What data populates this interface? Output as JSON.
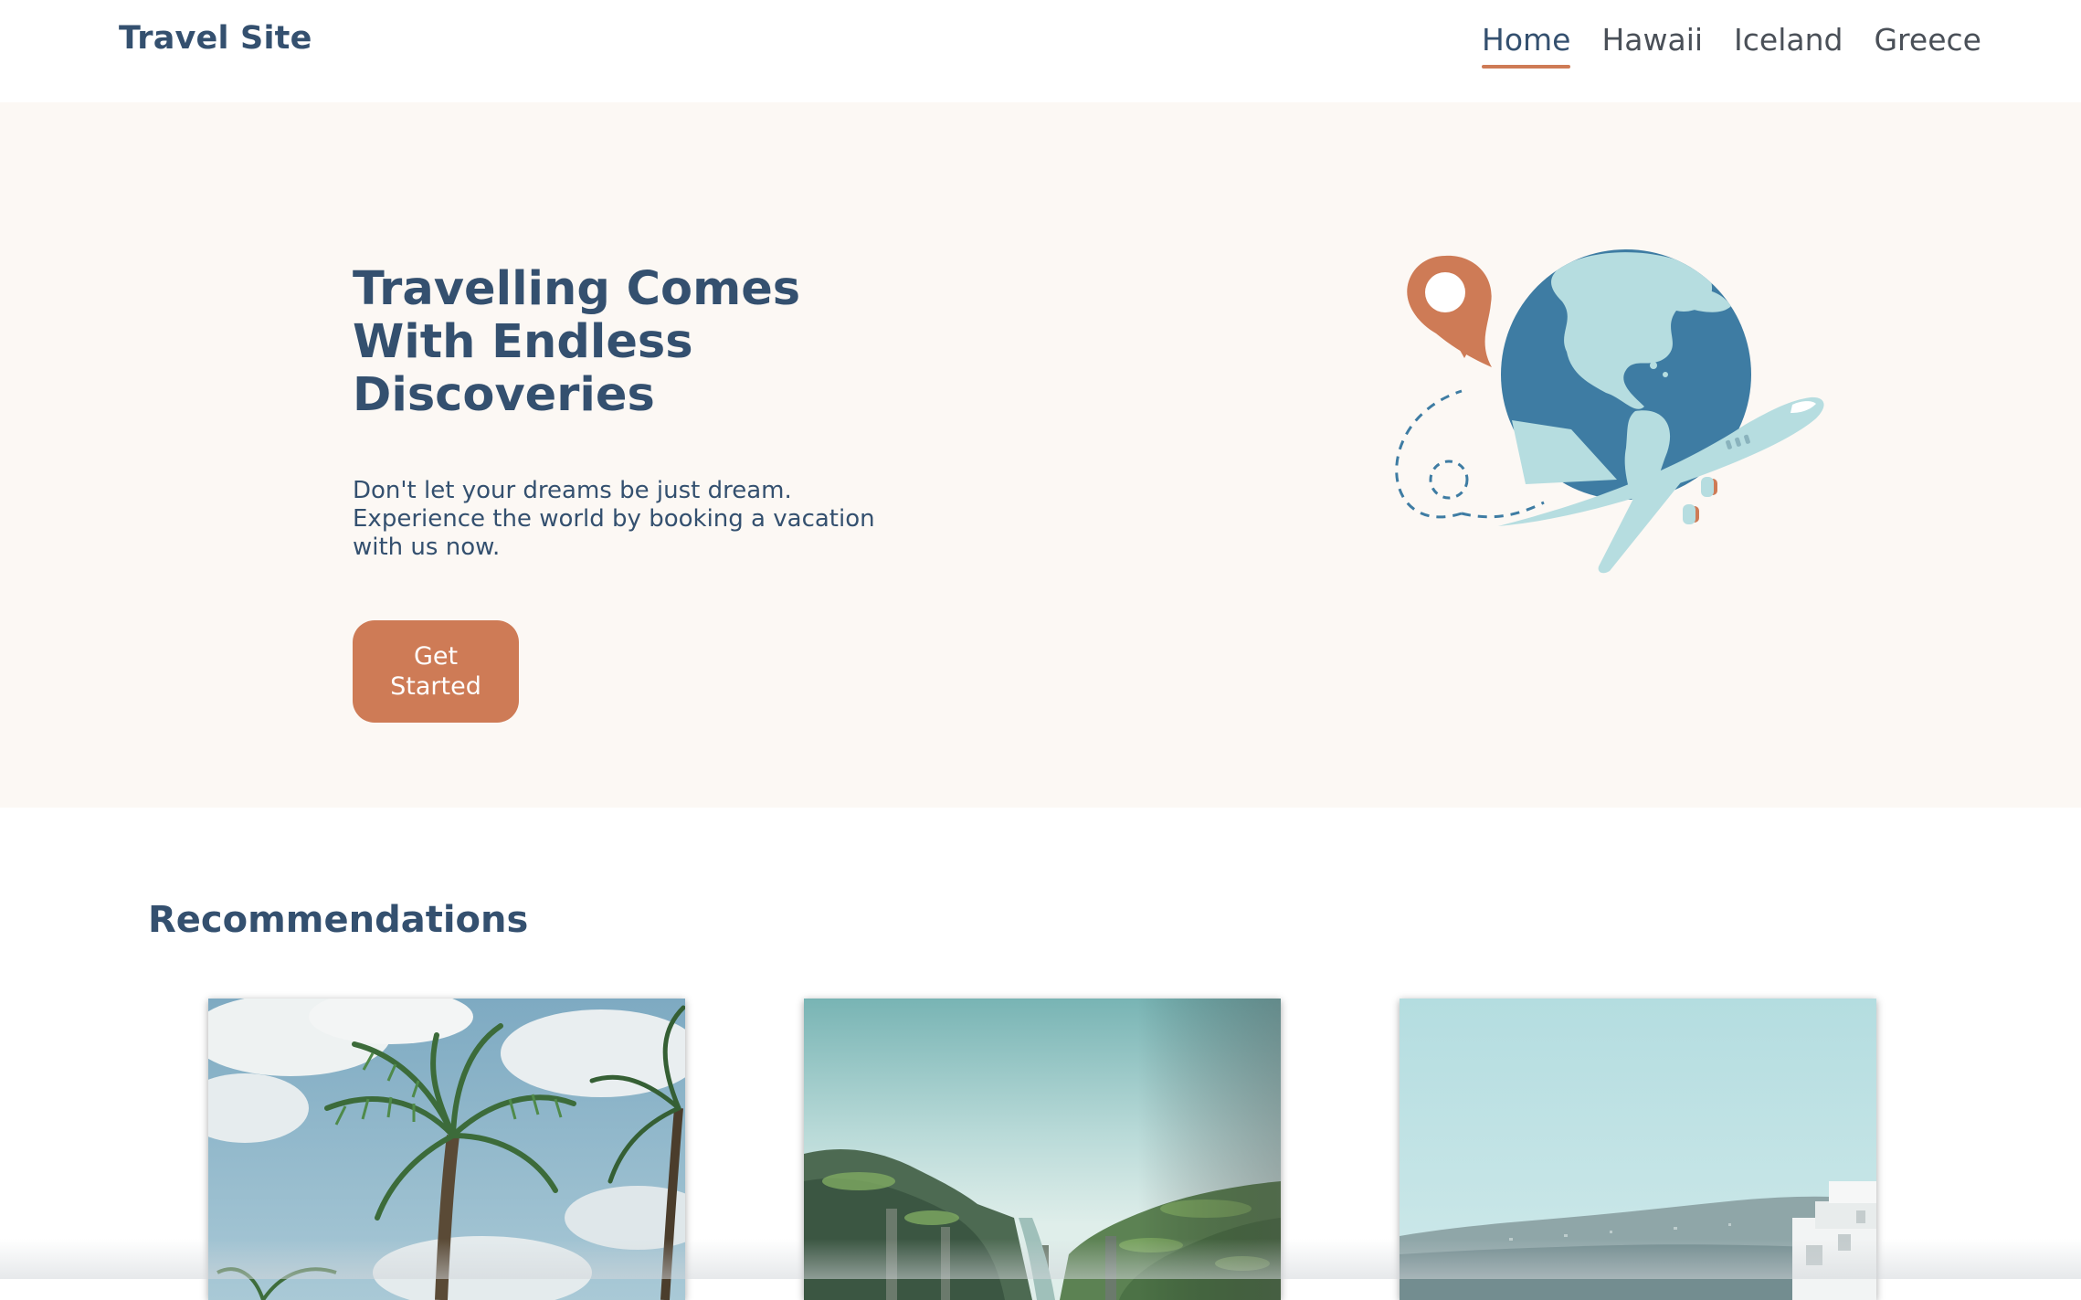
{
  "header": {
    "brand": "Travel Site",
    "nav": [
      {
        "label": "Home",
        "active": true
      },
      {
        "label": "Hawaii",
        "active": false
      },
      {
        "label": "Iceland",
        "active": false
      },
      {
        "label": "Greece",
        "active": false
      }
    ]
  },
  "hero": {
    "title": "Travelling Comes With Endless Discoveries",
    "subtitle": "Don't let your dreams be just dream. Experience the world by booking a vacation with us now.",
    "cta_label": "Get Started",
    "illustration": "globe-with-location-pin-and-airplane-illustration"
  },
  "recommendations": {
    "title": "Recommendations",
    "cards": [
      {
        "image": "palm-trees-photo"
      },
      {
        "image": "iceland-canyon-photo"
      },
      {
        "image": "greece-coast-photo"
      }
    ]
  },
  "colors": {
    "primary_text": "#34506f",
    "accent": "#ce7b56",
    "hero_background": "#fcf8f4",
    "globe_ocean": "#3e7ca3",
    "globe_land": "#b6dde0"
  }
}
